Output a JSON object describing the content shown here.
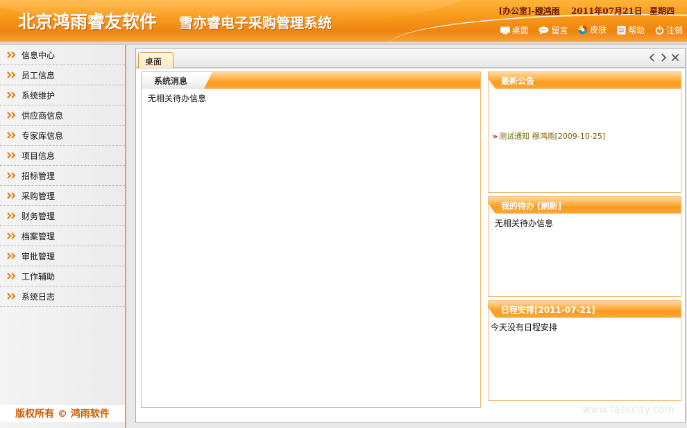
{
  "header": {
    "brand": "北京鸿雨睿友软件",
    "system_name": "雪亦睿电子采购管理系统",
    "office_prefix": "[办公室]-",
    "user_name": "穆鸿雨",
    "date": "2011年07月21日",
    "weekday": "星期四",
    "toolbar": [
      {
        "label": "桌面",
        "icon": "desktop-icon"
      },
      {
        "label": "留言",
        "icon": "message-icon"
      },
      {
        "label": "皮肤",
        "icon": "skin-icon"
      },
      {
        "label": "帮助",
        "icon": "help-icon"
      },
      {
        "label": "注销",
        "icon": "power-icon"
      }
    ]
  },
  "sidebar": {
    "items": [
      {
        "label": "信息中心"
      },
      {
        "label": "员工信息"
      },
      {
        "label": "系统维护"
      },
      {
        "label": "供应商信息"
      },
      {
        "label": "专家库信息"
      },
      {
        "label": "项目信息"
      },
      {
        "label": "招标管理"
      },
      {
        "label": "采购管理"
      },
      {
        "label": "财务管理"
      },
      {
        "label": "档案管理"
      },
      {
        "label": "审批管理"
      },
      {
        "label": "工作辅助"
      },
      {
        "label": "系统日志"
      }
    ],
    "copyright": "版权所有 © 鸿雨软件"
  },
  "main": {
    "tab_label": "桌面",
    "panels": {
      "system": {
        "title": "系统消息",
        "body": "无相关待办信息"
      },
      "notice": {
        "title": "最新公告",
        "item_title": "测试通知",
        "item_meta": "穆鸿雨[2009-10-25]"
      },
      "todo": {
        "title": "我的待办 [刷新]",
        "body": "无相关待办信息"
      },
      "schedule": {
        "title": "日程安排[2011-07-21]",
        "body": "今天没有日程安排"
      }
    }
  },
  "watermark": "www.taskcity.com",
  "colors": {
    "header_orange": "#f89a1a",
    "sidebar_border": "#ec9a3c",
    "copyright_text": "#cc5a00"
  }
}
